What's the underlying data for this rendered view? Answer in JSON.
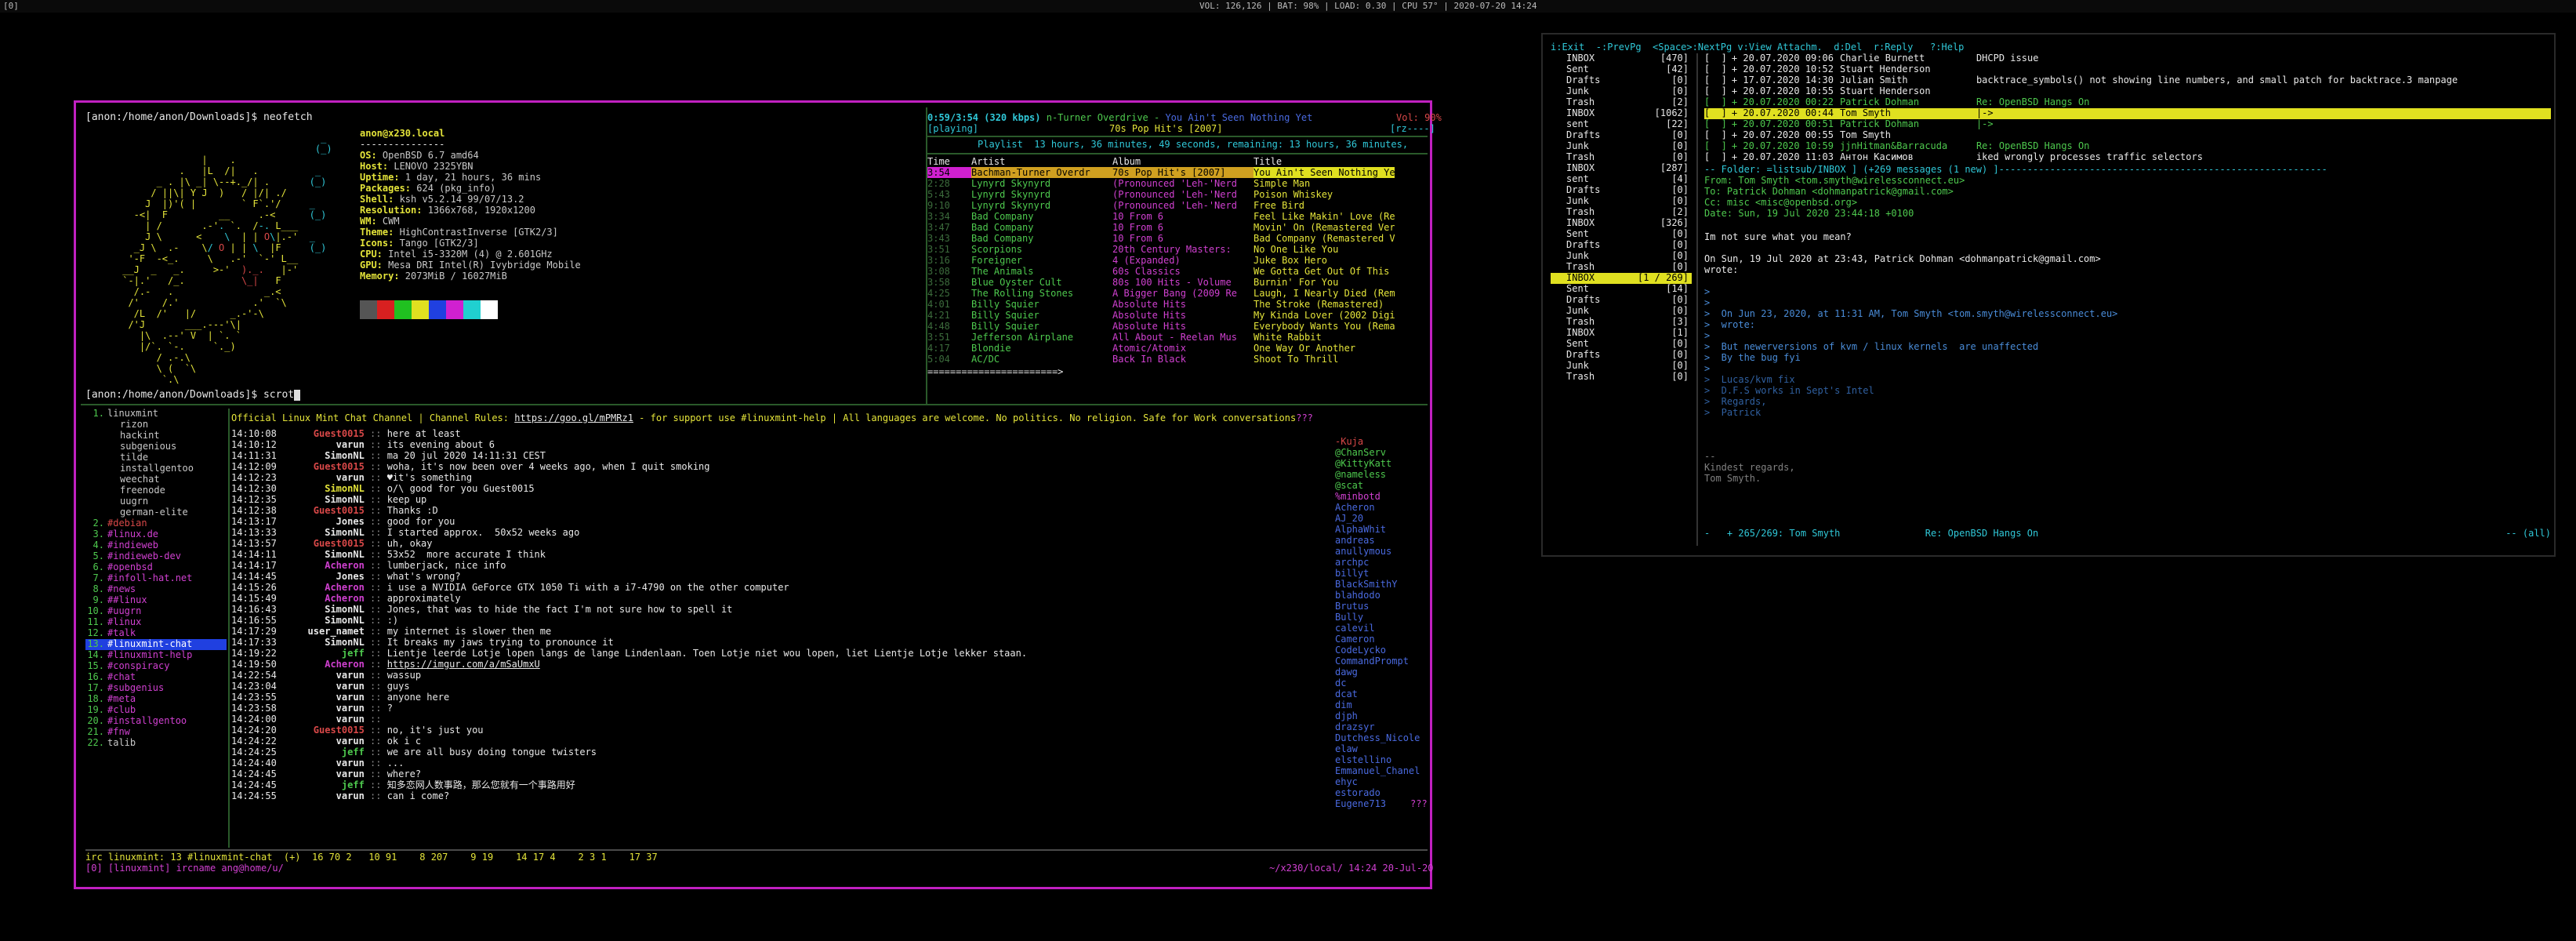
{
  "statusbar": {
    "workspace": "[0]",
    "right": "VOL: 126,126 | BAT: 98% | LOAD: 0.30 | CPU 57° | 2020-07-20 14:24"
  },
  "neofetch": {
    "prompt": "[anon:/home/anon/Downloads]$ neofetch",
    "user_host": "anon@x230.local",
    "sep": "---------------",
    "info": [
      {
        "k": "OS:",
        "v": " OpenBSD 6.7 amd64"
      },
      {
        "k": "Host:",
        "v": " LENOVO 2325YBN"
      },
      {
        "k": "Uptime:",
        "v": " 1 day, 21 hours, 36 mins"
      },
      {
        "k": "Packages:",
        "v": " 624 (pkg_info)"
      },
      {
        "k": "Shell:",
        "v": " ksh v5.2.14 99/07/13.2"
      },
      {
        "k": "Resolution:",
        "v": " 1366x768, 1920x1200"
      },
      {
        "k": "WM:",
        "v": " CWM"
      },
      {
        "k": "Theme:",
        "v": " HighContrastInverse [GTK2/3]"
      },
      {
        "k": "Icons:",
        "v": " Tango [GTK2/3]"
      },
      {
        "k": "CPU:",
        "v": " Intel i5-3320M (4) @ 2.601GHz"
      },
      {
        "k": "GPU:",
        "v": " Mesa DRI Intel(R) Ivybridge Mobile"
      },
      {
        "k": "Memory:",
        "v": " 2073MiB / 16027MiB"
      }
    ],
    "colors": [
      "#555555",
      "#d82020",
      "#20c020",
      "#e0e020",
      "#2040e0",
      "#d020d0",
      "#20d0d0",
      "#ffffff"
    ],
    "prompt2": "[anon:/home/anon/Downloads]$ scrot"
  },
  "music": {
    "now": "0:59/3:54 (320 kbps)",
    "artist_title": "n-Turner Overdrive - ",
    "trail": "You Ain't Seen Nothing Yet",
    "vol": "Vol: 90%",
    "state": "[playing]",
    "album": "70s Pop Hit's [2007]",
    "flags": "[rz----]",
    "playlist": "Playlist  13 hours, 36 minutes, 49 seconds, remaining: 13 hours, 36 minutes,",
    "headers": [
      "Time",
      "Artist",
      "Album",
      "Title"
    ],
    "rows": [
      [
        "3:54",
        "Bachman-Turner Overdr",
        "70s Pop Hit's [2007]",
        "You Ain't Seen Nothing Ye"
      ],
      [
        "2:28",
        "Lynyrd Skynyrd",
        "(Pronounced 'Leh-'Nerd",
        "Simple Man"
      ],
      [
        "5:43",
        "Lynyrd Skynyrd",
        "(Pronounced 'Leh-'Nerd",
        "Poison Whiskey"
      ],
      [
        "9:10",
        "Lynyrd Skynyrd",
        "(Pronounced 'Leh-'Nerd",
        "Free Bird"
      ],
      [
        "3:34",
        "Bad Company",
        "10 From 6",
        "Feel Like Makin' Love (Re"
      ],
      [
        "3:47",
        "Bad Company",
        "10 From 6",
        "Movin' On (Remastered Ver"
      ],
      [
        "3:43",
        "Bad Company",
        "10 From 6",
        "Bad Company (Remastered V"
      ],
      [
        "3:51",
        "Scorpions",
        "20th Century Masters:",
        "No One Like You"
      ],
      [
        "3:16",
        "Foreigner",
        "4 (Expanded)",
        "Juke Box Hero"
      ],
      [
        "3:08",
        "The Animals",
        "60s Classics",
        "We Gotta Get Out Of This"
      ],
      [
        "3:58",
        "Blue Oyster Cult",
        "80s 100 Hits - Volume",
        "Burnin' For You"
      ],
      [
        "4:25",
        "The Rolling Stones",
        "A Bigger Bang (2009 Re",
        "Laugh, I Nearly Died (Rem"
      ],
      [
        "4:01",
        "Billy Squier",
        "Absolute Hits",
        "The Stroke (Remastered)"
      ],
      [
        "4:21",
        "Billy Squier",
        "Absolute Hits",
        "My Kinda Lover (2002 Digi"
      ],
      [
        "4:48",
        "Billy Squier",
        "Absolute Hits",
        "Everybody Wants You (Rema"
      ],
      [
        "3:51",
        "Jefferson Airplane",
        "All About - Reelan Mus",
        "White Rabbit"
      ],
      [
        "4:17",
        "Blondie",
        "Atomic/Atomix",
        "One Way Or Another"
      ],
      [
        "5:04",
        "AC/DC",
        "Back In Black",
        "Shoot To Thrill"
      ]
    ],
    "progress": "=======================>"
  },
  "irc": {
    "channels": [
      [
        "1.",
        "linuxmint"
      ],
      [
        "",
        "rizon"
      ],
      [
        "",
        "hackint"
      ],
      [
        "",
        "subgenious"
      ],
      [
        "",
        "tilde"
      ],
      [
        "",
        "installgentoo"
      ],
      [
        "",
        "weechat"
      ],
      [
        "",
        "freenode"
      ],
      [
        "",
        "uugrn"
      ],
      [
        "",
        "german-elite"
      ],
      [
        "2.",
        "#debian"
      ],
      [
        "3.",
        "#linux.de"
      ],
      [
        "4.",
        "#indieweb"
      ],
      [
        "5.",
        "#indieweb-dev"
      ],
      [
        "6.",
        "#openbsd"
      ],
      [
        "7.",
        "#infoll-hat.net"
      ],
      [
        "8.",
        "#news"
      ],
      [
        "9.",
        "##linux"
      ],
      [
        "10.",
        "#uugrn"
      ],
      [
        "11.",
        "#linux"
      ],
      [
        "12.",
        "#talk"
      ],
      [
        "13.",
        "#linuxmint-chat"
      ],
      [
        "14.",
        "#linuxmint-help"
      ],
      [
        "15.",
        "#conspiracy"
      ],
      [
        "16.",
        "#chat"
      ],
      [
        "17.",
        "#subgenius"
      ],
      [
        "18.",
        "#meta"
      ],
      [
        "19.",
        "#club"
      ],
      [
        "20.",
        "#installgentoo"
      ],
      [
        "21.",
        "#fnw"
      ],
      [
        "22.",
        "talib"
      ]
    ],
    "topic_a": "Official Linux Mint Chat Channel | Channel Rules: ",
    "topic_url": "https://goo.gl/mPMRz1",
    "topic_b": " - for support use #linuxmint-help | All languages are welcome. No politics. No religion. Safe for Work conversations",
    "topic_end": "???",
    "lines": [
      [
        "14:10:08",
        "Guest0015",
        "here at least",
        "r"
      ],
      [
        "14:10:12",
        "varun",
        "its evening about 6",
        "w"
      ],
      [
        "14:11:31",
        "SimonNL",
        "ma 20 jul 2020 14:11:31 CEST",
        "w"
      ],
      [
        "14:12:09",
        "Guest0015",
        "woha, it's now been over 4 weeks ago, when I quit smoking",
        "r"
      ],
      [
        "14:12:23",
        "varun",
        "♥it's something",
        "w"
      ],
      [
        "14:12:30",
        "SimonNL",
        "o/\\ good for you Guest0015",
        "y"
      ],
      [
        "14:12:35",
        "SimonNL",
        "keep up",
        "w"
      ],
      [
        "14:12:38",
        "Guest0015",
        "Thanks :D",
        "r"
      ],
      [
        "14:13:17",
        "Jones",
        "good for you",
        "w"
      ],
      [
        "14:13:33",
        "SimonNL",
        "I started approx.  50x52 weeks ago",
        "w"
      ],
      [
        "14:13:57",
        "Guest0015",
        "uh, okay",
        "r"
      ],
      [
        "14:14:11",
        "SimonNL",
        "53x52  more accurate I think",
        "w"
      ],
      [
        "14:14:17",
        "Acheron",
        "lumberjack, nice info",
        "m"
      ],
      [
        "14:14:45",
        "Jones",
        "what's wrong?",
        "w"
      ],
      [
        "14:15:26",
        "Acheron",
        "i use a NVIDIA GeForce GTX 1050 Ti with a i7-4790 on the other computer",
        "m"
      ],
      [
        "14:15:49",
        "Acheron",
        "approximately",
        "m"
      ],
      [
        "14:16:43",
        "SimonNL",
        "Jones, that was to hide the fact I'm not sure how to spell it",
        "w"
      ],
      [
        "14:16:55",
        "SimonNL",
        ":)",
        "w"
      ],
      [
        "14:17:29",
        "user_namet",
        "my internet is slower then me",
        "w"
      ],
      [
        "14:17:33",
        "SimonNL",
        "It breaks my jaws trying to pronounce it",
        "w"
      ],
      [
        "14:19:22",
        "jeff",
        "Lientje leerde Lotje lopen langs de lange Lindenlaan. Toen Lotje niet wou lopen, liet Lientje Lotje lekker staan.",
        "g"
      ],
      [
        "14:19:50",
        "Acheron",
        "https://imgur.com/a/mSaUmxU",
        "m"
      ],
      [
        "14:22:54",
        "varun",
        "wassup",
        "w"
      ],
      [
        "14:23:04",
        "varun",
        "guys",
        "w"
      ],
      [
        "14:23:55",
        "varun",
        "anyone here",
        "w"
      ],
      [
        "14:23:58",
        "varun",
        "?",
        "w"
      ],
      [
        "14:24:00",
        "varun",
        "",
        "w"
      ],
      [
        "14:24:20",
        "Guest0015",
        "no, it's just you",
        "r"
      ],
      [
        "14:24:22",
        "varun",
        "ok i c",
        "w"
      ],
      [
        "14:24:25",
        "jeff",
        "we are all busy doing tongue twisters",
        "g"
      ],
      [
        "14:24:40",
        "varun",
        "...",
        "w"
      ],
      [
        "14:24:45",
        "varun",
        "where?",
        "w"
      ],
      [
        "14:24:45",
        "jeff",
        "知多恋网人数事路，那么您就有一个事路用好",
        "g"
      ],
      [
        "14:24:55",
        "varun",
        "can i come?",
        "w"
      ]
    ],
    "nicks": [
      [
        "-Kuja",
        "r"
      ],
      [
        "@ChanServ",
        "g"
      ],
      [
        "@KittyKatt",
        "g"
      ],
      [
        "@nameless",
        "g"
      ],
      [
        "@scat",
        "g"
      ],
      [
        "%minbotd",
        "m"
      ],
      [
        "Acheron",
        "b"
      ],
      [
        "AJ_20",
        "b"
      ],
      [
        "AlphaWhit",
        "b"
      ],
      [
        "andreas",
        "b"
      ],
      [
        "anullymous",
        "b"
      ],
      [
        "archpc",
        "b"
      ],
      [
        "billyt",
        "b"
      ],
      [
        "BlackSmithY",
        "b"
      ],
      [
        "blahdodo",
        "b"
      ],
      [
        "Brutus",
        "b"
      ],
      [
        "Bully",
        "b"
      ],
      [
        "calevil",
        "b"
      ],
      [
        "Cameron",
        "b"
      ],
      [
        "CodeLycko",
        "b"
      ],
      [
        "CommandPrompt",
        "b"
      ],
      [
        "dawg",
        "b"
      ],
      [
        "dc",
        "b"
      ],
      [
        "dcat",
        "b"
      ],
      [
        "dim",
        "b"
      ],
      [
        "djph",
        "b"
      ],
      [
        "drazsyr",
        "b"
      ],
      [
        "Dutchess_Nicole",
        "b"
      ],
      [
        "elaw",
        "b"
      ],
      [
        "elstellino",
        "b"
      ],
      [
        "Emmanuel_Chanel",
        "b"
      ],
      [
        "ehyc",
        "b"
      ],
      [
        "estorado",
        "b"
      ],
      [
        "Eugene713",
        "b"
      ]
    ],
    "nick_more": "???",
    "status": "irc linuxmint: 13 #linuxmint-chat  (+)  16 70 2   10 91    8 207    9 19    14 17 4    2 3 1    17 37",
    "status_right": "",
    "input_left": "[0] [linuxmint] ircname ang@home/u/",
    "input_right": "~/x230/local/ 14:24 20-Jul-20"
  },
  "mutt": {
    "help": "i:Exit  -:PrevPg  <Space>:NextPg v:View Attachm.  d:Del  r:Reply   ?:Help",
    "folders": [
      [
        "INBOX",
        "[470]"
      ],
      [
        "Sent",
        "[42]"
      ],
      [
        "Drafts",
        "[0]"
      ],
      [
        "Junk",
        "[0]"
      ],
      [
        "Trash",
        "[2]"
      ],
      [
        "INBOX",
        "[1062]"
      ],
      [
        "sent",
        "[22]"
      ],
      [
        "Drafts",
        "[0]"
      ],
      [
        "Junk",
        "[0]"
      ],
      [
        "Trash",
        "[0]"
      ],
      [
        "INBOX",
        "[287]"
      ],
      [
        "sent",
        "[4]"
      ],
      [
        "Drafts",
        "[0]"
      ],
      [
        "Junk",
        "[0]"
      ],
      [
        "Trash",
        "[2]"
      ],
      [
        "INBOX",
        "[326]"
      ],
      [
        "Sent",
        "[0]"
      ],
      [
        "Drafts",
        "[0]"
      ],
      [
        "Junk",
        "[0]"
      ],
      [
        "Trash",
        "[0]"
      ],
      [
        "INBOX",
        "[1 / 269]"
      ],
      [
        "Sent",
        "[14]"
      ],
      [
        "Drafts",
        "[0]"
      ],
      [
        "Junk",
        "[0]"
      ],
      [
        "Trash",
        "[3]"
      ],
      [
        "INBOX",
        "[1]"
      ],
      [
        "Sent",
        "[0]"
      ],
      [
        "Drafts",
        "[0]"
      ],
      [
        "Junk",
        "[0]"
      ],
      [
        "Trash",
        "[0]"
      ]
    ],
    "index": [
      [
        "[  ]",
        "+ 20.07.2020 09:06",
        "Charlie Burnett",
        "DHCPD issue"
      ],
      [
        "[  ]",
        "+ 20.07.2020 10:52",
        "Stuart Henderson",
        ""
      ],
      [
        "[  ]",
        "+ 17.07.2020 14:30",
        "Julian Smith",
        "backtrace_symbols() not showing line numbers, and small patch for backtrace.3 manpage"
      ],
      [
        "[  ]",
        "+ 20.07.2020 10:55",
        "Stuart Henderson",
        ""
      ],
      [
        "[  ]",
        "+ 20.07.2020 00:22",
        "Patrick Dohman",
        "Re: OpenBSD Hangs On"
      ],
      [
        "[  ]",
        "+ 20.07.2020 00:44",
        "Tom Smyth",
        "|->"
      ],
      [
        "[  ]",
        "+ 20.07.2020 00:51",
        "Patrick Dohman",
        "|->"
      ],
      [
        "[  ]",
        "+ 20.07.2020 00:55",
        "Tom Smyth",
        ""
      ],
      [
        "[  ]",
        "+ 20.07.2020 10:59",
        "jjnHitman&Barracuda",
        "Re: OpenBSD Hangs On"
      ],
      [
        "[  ]",
        "+ 20.07.2020 11:03",
        "Антон Касимов",
        "iked wrongly processes traffic selectors"
      ]
    ],
    "folder_bar": "-- Folder: =listsub/INBOX ] (+269 messages (1 new) ]----------------------------------------------------------",
    "headers": [
      "From: Tom Smyth <tom.smyth@wirelessconnect.eu>",
      "To: Patrick Dohman <dohmanpatrick@gmail.com>",
      "Cc: misc <misc@openbsd.org>",
      "Date: Sun, 19 Jul 2020 23:44:18 +0100"
    ],
    "body": [
      [
        "Im not sure what you mean?",
        "w"
      ],
      [
        "",
        ""
      ],
      [
        "On Sun, 19 Jul 2020 at 23:43, Patrick Dohman <dohmanpatrick@gmail.com>",
        "w"
      ],
      [
        "wrote:",
        "w"
      ],
      [
        "",
        ""
      ],
      [
        ">",
        "bl"
      ],
      [
        ">",
        "bl"
      ],
      [
        ">  On Jun 23, 2020, at 11:31 AM, Tom Smyth <tom.smyth@wirelessconnect.eu>",
        "bl"
      ],
      [
        ">  wrote:",
        "bl"
      ],
      [
        ">",
        "bl"
      ],
      [
        ">  But newerversions of kvm / linux kernels  are unaffected",
        "bl"
      ],
      [
        ">  By the bug fyi",
        "bl"
      ],
      [
        ">",
        "bl"
      ],
      [
        ">  Lucas/kvm fix",
        "dbl"
      ],
      [
        ">  D.F.S works in Sept's Intel",
        "dbl"
      ],
      [
        ">  Regards,",
        "dbl"
      ],
      [
        ">  Patrick",
        "dbl"
      ],
      [
        "",
        ""
      ],
      [
        "",
        ""
      ],
      [
        "",
        ""
      ],
      [
        "--",
        "gr"
      ],
      [
        "Kindest regards,",
        "gr"
      ],
      [
        "Tom Smyth.",
        "gr"
      ]
    ],
    "pager_status": "-   + 265/269: Tom Smyth               Re: OpenBSD Hangs On",
    "pager_pos": "-- (all)"
  }
}
